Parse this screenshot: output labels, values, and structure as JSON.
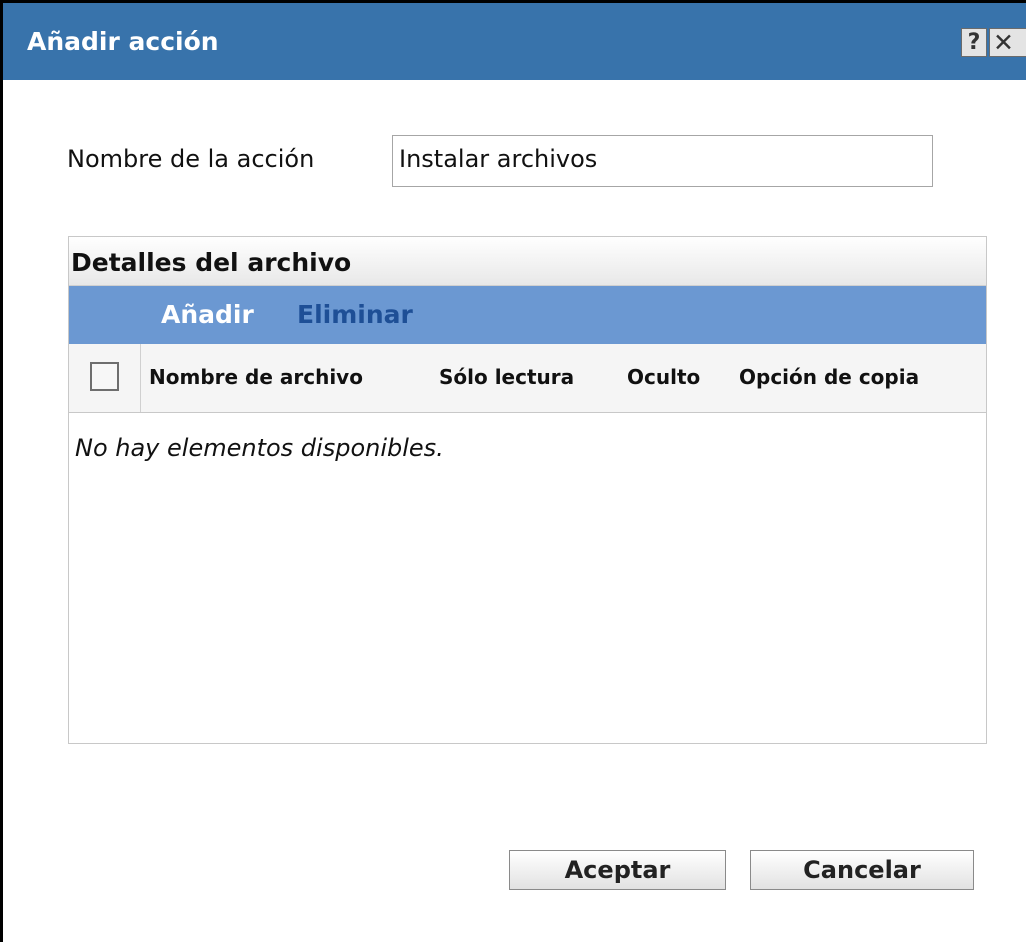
{
  "dialog": {
    "title": "Añadir acción",
    "help_label": "?",
    "close_label": "✕"
  },
  "form": {
    "action_name_label": "Nombre de la acción",
    "action_name_value": "Instalar archivos"
  },
  "file_details": {
    "title": "Detalles del archivo",
    "toolbar": {
      "add_label": "Añadir",
      "remove_label": "Eliminar"
    },
    "columns": [
      "Nombre de archivo",
      "Sólo lectura",
      "Oculto",
      "Opción de copia"
    ],
    "empty_message": "No hay elementos disponibles."
  },
  "buttons": {
    "ok_label": "Aceptar",
    "cancel_label": "Cancelar"
  }
}
